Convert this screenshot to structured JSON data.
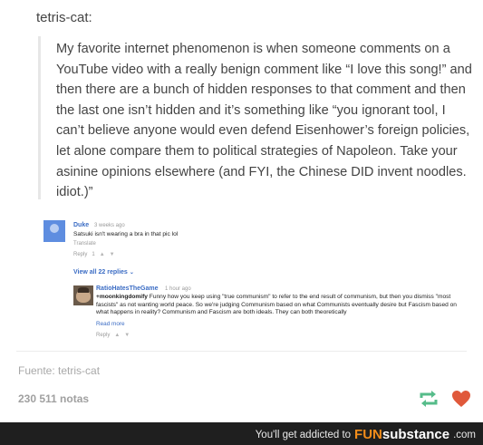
{
  "post": {
    "author": "tetris-cat:",
    "quote": "My favorite internet phenomenon is when someone comments on a YouTube video with a really benign comment like “I love this song!” and then there are a bunch of hidden responses to that comment and then the last one isn’t hidden and it’s something like “you ignorant tool, I can’t believe anyone would even defend Eisenhower’s foreign policies, let alone compare them to political strategies of Napoleon. Take your asinine opinions elsewhere (and FYI, the Chinese DID invent noodles. idiot.)”",
    "source": "Fuente: tetris-cat",
    "notes": "230 511 notas"
  },
  "youtube": {
    "comment": {
      "name": "Duke",
      "time": "3 weeks ago",
      "text": "Satsuki isn't wearing a bra in that pic lol",
      "translate": "Translate",
      "reply_label": "Reply",
      "likes": "1"
    },
    "view_all": "View all 22 replies",
    "reply": {
      "name": "RatioHatesTheGame",
      "time": "1 hour ago",
      "mention": "+moonkingdomify",
      "text": " Funny how you keep using \"true communism\" to refer to the end result of communism, but then you dismiss \"most fascists\" as not wanting world peace. So we're judging Communism based on what Communists eventually desire but Fascism based on what happens in reality? Communism and Fascism are both ideals. They can both theoretically",
      "read_more": "Read more",
      "reply_label": "Reply"
    }
  },
  "footer": {
    "tagline": "You'll get addicted to",
    "brand_fun": "FUN",
    "brand_sub": "substance",
    "brand_tld": ".com"
  },
  "icons": {
    "reblog": "reblog-icon",
    "like": "heart-icon",
    "thumb_up": "thumb-up-icon",
    "thumb_down": "thumb-down-icon",
    "chevron": "chevron-down-icon"
  },
  "colors": {
    "reblog": "#56bc8a",
    "like": "#e0593b",
    "link": "#3b6cc4",
    "footer_bg": "#1f1f1f",
    "brand_orange": "#f28c1a"
  }
}
